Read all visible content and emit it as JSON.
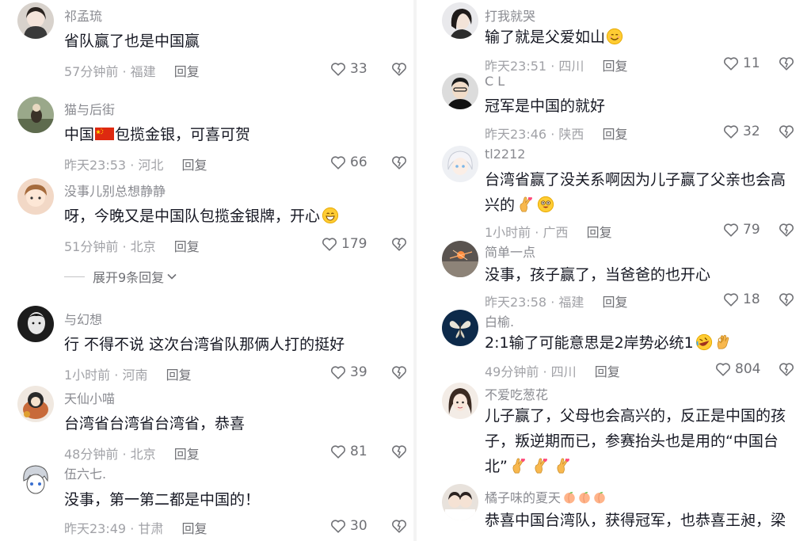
{
  "left": {
    "comments": [
      {
        "user": "祁孟琉",
        "text": "省队赢了也是中国赢",
        "time": "57分钟前",
        "location": "福建",
        "reply": "回复",
        "likes": "33"
      },
      {
        "user": "猫与后街",
        "text_a": "中国",
        "text_b": "包揽金银，可喜可贺",
        "time": "昨天23:53",
        "location": "河北",
        "reply": "回复",
        "likes": "66"
      },
      {
        "user": "没事儿别总想静静",
        "text": "呀，今晚又是中国队包揽金银牌，开心",
        "time": "51分钟前",
        "location": "北京",
        "reply": "回复",
        "likes": "179"
      },
      {
        "user": "与幻想",
        "text": "行 不得不说 这次台湾省队那俩人打的挺好",
        "time": "1小时前",
        "location": "河南",
        "reply": "回复",
        "likes": "39"
      },
      {
        "user": "天仙小喵",
        "text": "台湾省台湾省台湾省，恭喜",
        "time": "48分钟前",
        "location": "北京",
        "reply": "回复",
        "likes": "81"
      },
      {
        "user": "伍六七.",
        "text": "没事，第一第二都是中国的！",
        "time": "昨天23:49",
        "location": "甘肃",
        "reply": "回复",
        "likes": "30"
      }
    ],
    "expand_replies": "展开9条回复"
  },
  "right": {
    "comments": [
      {
        "user": "打我就哭",
        "text": "输了就是父爱如山",
        "time": "昨天23:51",
        "location": "四川",
        "reply": "回复",
        "likes": "11"
      },
      {
        "user": "C L",
        "text": "冠军是中国的就好",
        "time": "昨天23:46",
        "location": "陕西",
        "reply": "回复",
        "likes": "32"
      },
      {
        "user": "tl2212",
        "text_l1": "台湾省赢了没关系啊因为儿子赢了父亲也会高",
        "text_l2": "兴的",
        "time": "1小时前",
        "location": "广西",
        "reply": "回复",
        "likes": "79"
      },
      {
        "user": "简单一点",
        "text": "没事，孩子赢了，当爸爸的也开心",
        "time": "昨天23:58",
        "location": "福建",
        "reply": "回复",
        "likes": "18"
      },
      {
        "user": "白榆.",
        "text": "2:1输了可能意思是2岸势必统1",
        "time": "49分钟前",
        "location": "四川",
        "reply": "回复",
        "likes": "804"
      },
      {
        "user": "不爱吃葱花",
        "text_l1": "儿子赢了，父母也会高兴的，反正是中国的孩",
        "text_l2": "子，叛逆期而已，参赛抬头也是用的“中国台",
        "text_l3": "北”"
      },
      {
        "user": "橘子味的夏天",
        "text_l1": "恭喜中国台湾队，获得冠军，也恭喜王昶，梁"
      }
    ]
  },
  "meta_separator": " · ",
  "icons": {
    "like": "heart-outline-icon",
    "dislike": "broken-heart-icon",
    "chevron": "chevron-down-icon"
  },
  "colors": {
    "text": "#161823",
    "username": "#8a8b91",
    "meta": "#a1a2a7",
    "icon": "#6f7075",
    "flag_red": "#de2910",
    "flag_yellow": "#ffde00"
  }
}
